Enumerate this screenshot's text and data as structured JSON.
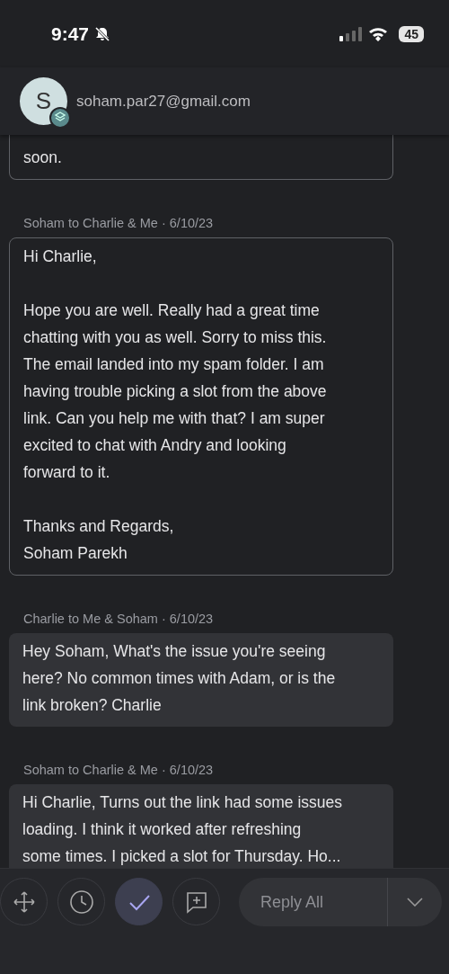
{
  "status_bar": {
    "time": "9:47",
    "battery": "45"
  },
  "header": {
    "avatar_letter": "S",
    "email": "soham.par27@gmail.com"
  },
  "messages": [
    {
      "kind": "outlined",
      "paragraphs": [
        [
          "soon."
        ]
      ]
    },
    {
      "kind": "outlined",
      "meta": "Soham to Charlie & Me · 6/10/23",
      "paragraphs": [
        [
          "Hi Charlie,"
        ],
        [
          "Hope you are well. Really had a great time",
          "chatting with you as well. Sorry to miss this.",
          "The email landed into my spam folder. I am",
          "having trouble picking a slot from the above",
          "link. Can you help me with that? I am super",
          "excited to chat with Andry and looking",
          "forward to it."
        ],
        [
          "Thanks and Regards,",
          "Soham Parekh"
        ]
      ]
    },
    {
      "kind": "filled",
      "meta": "Charlie to Me & Soham · 6/10/23",
      "paragraphs": [
        [
          "Hey Soham, What's the issue you're seeing",
          "here? No common times with Adam, or is the",
          "link broken? Charlie"
        ]
      ]
    },
    {
      "kind": "filled",
      "meta": "Soham to Charlie & Me · 6/10/23",
      "paragraphs": [
        [
          "Hi Charlie, Turns out the link had some issues",
          "loading. I think it worked after refreshing",
          "some times. I picked a slot for Thursday. Ho..."
        ]
      ]
    }
  ],
  "actions": [
    {
      "kind": "move",
      "selected": false
    },
    {
      "kind": "snooze",
      "selected": false
    },
    {
      "kind": "done",
      "selected": true
    },
    {
      "kind": "comment",
      "selected": false
    }
  ],
  "reply": {
    "label": "Reply All"
  }
}
